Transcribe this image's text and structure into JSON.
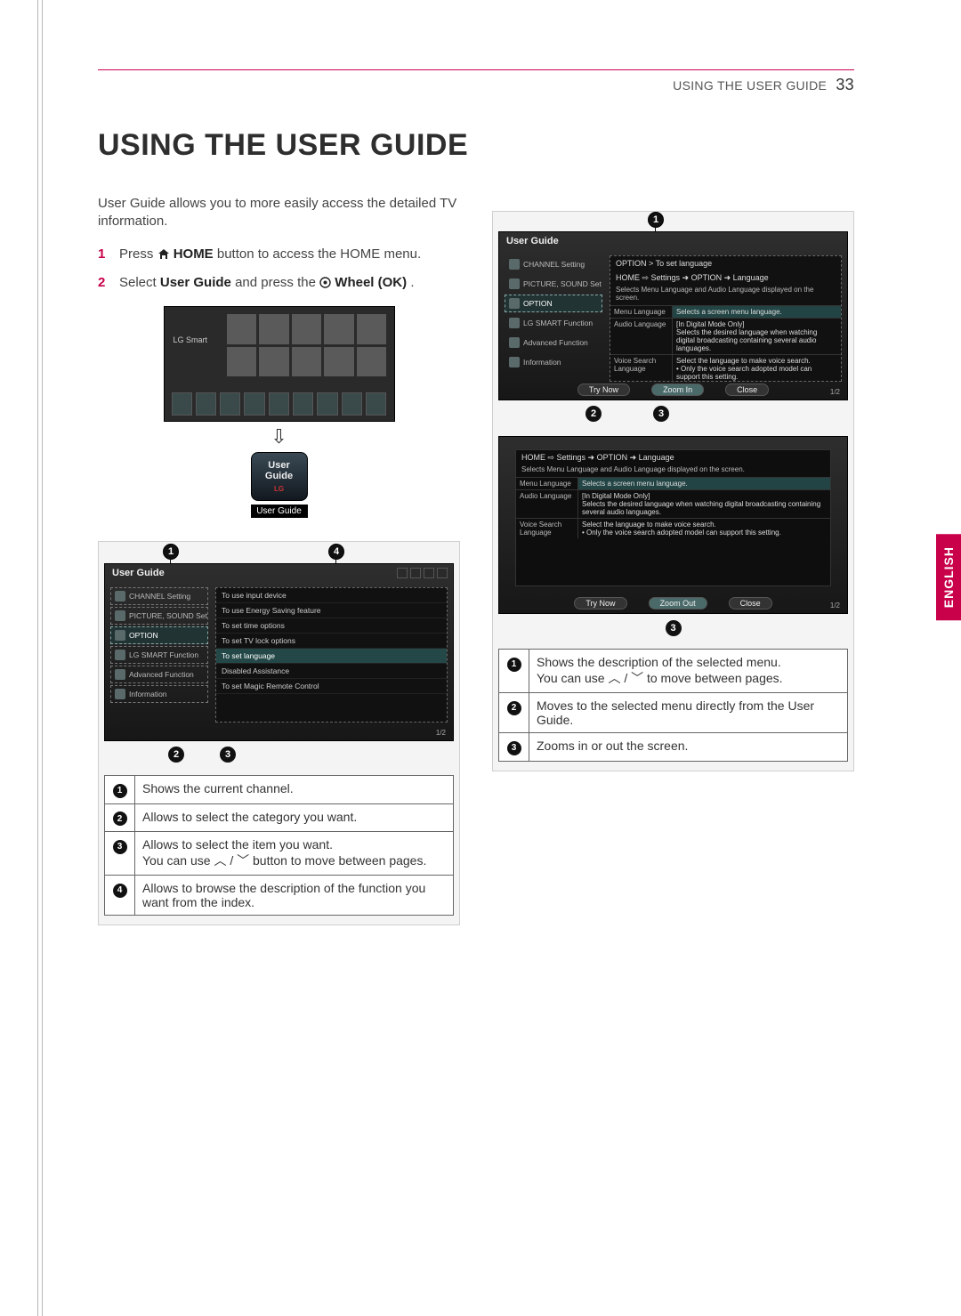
{
  "header": {
    "section": "USING THE USER GUIDE",
    "page": "33"
  },
  "title": "USING THE USER GUIDE",
  "language_tab": "ENGLISH",
  "intro": "User Guide allows you to more easily access the detailed TV information.",
  "steps": [
    {
      "n": "1",
      "pre": "Press ",
      "bold1": "HOME",
      "post": " button to access the HOME menu."
    },
    {
      "n": "2",
      "pre": "Select ",
      "bold1": "User Guide",
      "mid": " and press the ",
      "bold2": "Wheel (OK)",
      "post": "."
    }
  ],
  "home_thumb": {
    "brand": "LG Smart",
    "app_icon_title": "User Guide",
    "app_icon_logo": "LG",
    "app_icon_caption": "User Guide"
  },
  "left_screen": {
    "title": "User Guide",
    "side_items": [
      "CHANNEL Setting",
      "PICTURE, SOUND Setting",
      "OPTION",
      "LG SMART Function",
      "Advanced Function",
      "Information"
    ],
    "side_active_index": 2,
    "main_items": [
      "To use input device",
      "To use Energy Saving feature",
      "To set time options",
      "To set TV lock options",
      "To set language",
      "Disabled Assistance",
      "To set Magic Remote Control"
    ],
    "main_hi_index": 4,
    "pager": "1/2"
  },
  "left_legend": [
    "Shows the current channel.",
    "Allows to select the category you want.",
    "Allows to select the item you want.\nYou can use ︿ / ﹀ button to move between pages.",
    "Allows to browse the description of the function you want from the index."
  ],
  "right_screen1": {
    "title": "User Guide",
    "crumb_title": "OPTION > To set language",
    "crumb_path_pre": "HOME ⇨ Settings ➜ OPTION ➜ Language",
    "sub": "Selects Menu Language and Audio Language displayed on the screen.",
    "rows": [
      {
        "k": "Menu Language",
        "v": "Selects a screen menu language."
      },
      {
        "k": "Audio Language",
        "v": "[In Digital Mode Only]\nSelects the desired language when watching digital broadcasting containing several audio languages."
      },
      {
        "k": "Voice Search Language",
        "v": "Select the language to make voice search.\n• Only the voice search adopted model can support this setting."
      }
    ],
    "buttons": [
      "Try Now",
      "Zoom In",
      "Close"
    ],
    "pager": "1/2"
  },
  "right_screen2": {
    "crumb_path_pre": "HOME ⇨ Settings ➜ OPTION ➜ Language",
    "sub": "Selects Menu Language and Audio Language displayed on the screen.",
    "rows": [
      {
        "k": "Menu Language",
        "v": "Selects a screen menu language."
      },
      {
        "k": "Audio Language",
        "v": "[In Digital Mode Only]\nSelects the desired language when watching digital broadcasting containing several audio languages."
      },
      {
        "k": "Voice Search Language",
        "v": "Select the language to make voice search.\n• Only the voice search adopted model can support this setting."
      }
    ],
    "buttons": [
      "Try Now",
      "Zoom Out",
      "Close"
    ],
    "pager": "1/2"
  },
  "right_legend": [
    "Shows the description of the selected menu.\nYou can use ︿ / ﹀ to move between pages.",
    "Moves to the selected menu directly from the User Guide.",
    "Zooms in or out the screen."
  ]
}
